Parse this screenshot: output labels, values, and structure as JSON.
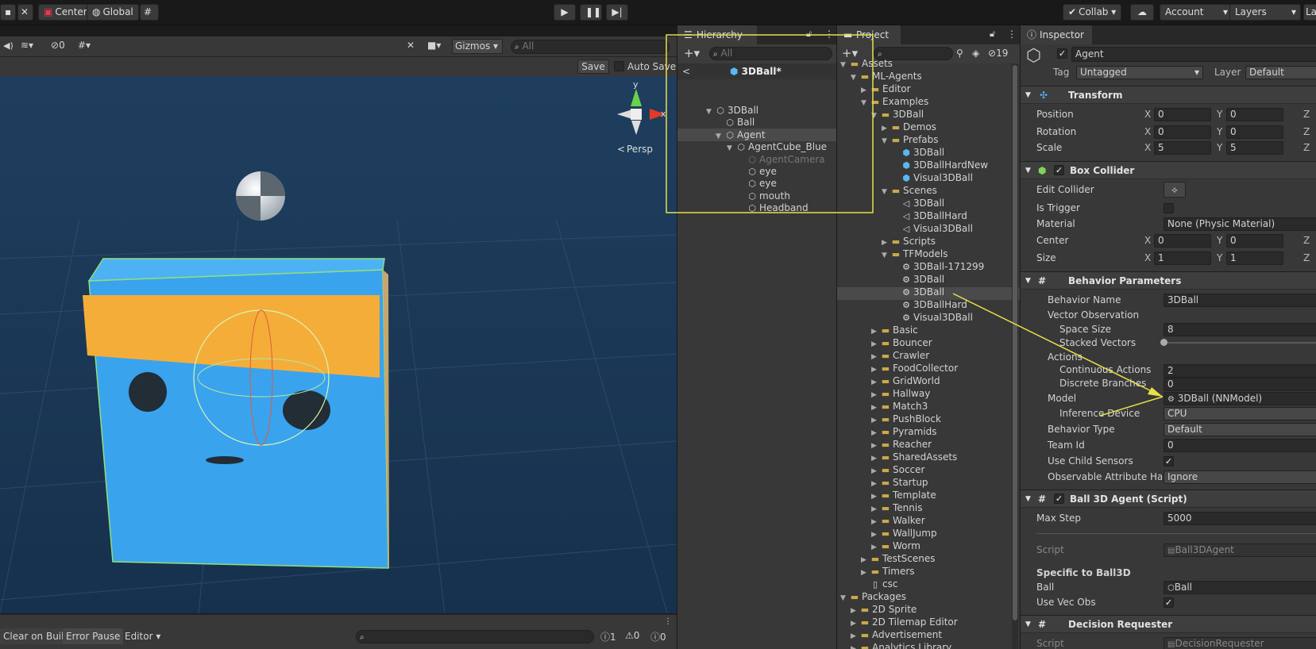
{
  "toolbar": {
    "center": "Center",
    "global": "Global",
    "collab": "Collab",
    "account": "Account",
    "layers": "Layers",
    "layout": "La"
  },
  "scene": {
    "gizmos": "Gizmos",
    "search_placeholder": "All",
    "save": "Save",
    "auto_save": "Auto Save",
    "hidden_count": "0",
    "persp": "Persp",
    "axis_y": "y",
    "axis_x": "x"
  },
  "console": {
    "clear_on_build": "Clear on Build",
    "error_pause": "Error Pause",
    "editor": "Editor",
    "count_info": "1",
    "count_warn": "0",
    "count_err": "0"
  },
  "hierarchy": {
    "title": "Hierarchy",
    "search_placeholder": "All",
    "scene_name": "3DBall*",
    "items": [
      "3DBall",
      "Ball",
      "Agent",
      "AgentCube_Blue",
      "AgentCamera",
      "eye",
      "eye",
      "mouth",
      "Headband"
    ]
  },
  "project": {
    "title": "Project",
    "badge": "19",
    "items": [
      "Assets",
      "ML-Agents",
      "Editor",
      "Examples",
      "3DBall",
      "Demos",
      "Prefabs",
      "3DBall",
      "3DBallHardNew",
      "Visual3DBall",
      "Scenes",
      "3DBall",
      "3DBallHard",
      "Visual3DBall",
      "Scripts",
      "TFModels",
      "3DBall-171299",
      "3DBall",
      "3DBall",
      "3DBallHard",
      "Visual3DBall",
      "Basic",
      "Bouncer",
      "Crawler",
      "FoodCollector",
      "GridWorld",
      "Hallway",
      "Match3",
      "PushBlock",
      "Pyramids",
      "Reacher",
      "SharedAssets",
      "Soccer",
      "Startup",
      "Template",
      "Tennis",
      "Walker",
      "WallJump",
      "Worm",
      "TestScenes",
      "Timers",
      "csc",
      "Packages",
      "2D Sprite",
      "2D Tilemap Editor",
      "Advertisement",
      "Analytics Library"
    ]
  },
  "inspector": {
    "title": "Inspector",
    "object_name": "Agent",
    "tag_label": "Tag",
    "tag_value": "Untagged",
    "layer_label": "Layer",
    "layer_value": "Default",
    "transform": {
      "title": "Transform",
      "position": "Position",
      "rotation": "Rotation",
      "scale": "Scale",
      "pos": [
        "0",
        "0"
      ],
      "rot": [
        "0",
        "0"
      ],
      "scl": [
        "5",
        "5"
      ]
    },
    "box_collider": {
      "title": "Box Collider",
      "edit_collider": "Edit Collider",
      "is_trigger": "Is Trigger",
      "material": "Material",
      "material_value": "None (Physic Material)",
      "center": "Center",
      "size": "Size",
      "center_v": [
        "0",
        "0"
      ],
      "size_v": [
        "1",
        "1"
      ]
    },
    "behavior": {
      "title": "Behavior Parameters",
      "behavior_name": "Behavior Name",
      "behavior_name_value": "3DBall",
      "vector_observation": "Vector Observation",
      "space_size": "Space Size",
      "space_size_value": "8",
      "stacked_vectors": "Stacked Vectors",
      "actions": "Actions",
      "continuous_actions": "Continuous Actions",
      "continuous_actions_value": "2",
      "discrete_branches": "Discrete Branches",
      "discrete_branches_value": "0",
      "model": "Model",
      "model_value": "3DBall (NNModel)",
      "inference_device": "Inference Device",
      "inference_device_value": "CPU",
      "behavior_type": "Behavior Type",
      "behavior_type_value": "Default",
      "team_id": "Team Id",
      "team_id_value": "0",
      "use_child_sensors": "Use Child Sensors",
      "observable": "Observable Attribute Hanc",
      "observable_value": "Ignore"
    },
    "agent_script": {
      "title": "Ball 3D Agent (Script)",
      "max_step": "Max Step",
      "max_step_value": "5000",
      "script": "Script",
      "script_value": "Ball3DAgent",
      "specific": "Specific to Ball3D",
      "ball": "Ball",
      "ball_value": "Ball",
      "use_vec_obs": "Use Vec Obs"
    },
    "decision": {
      "title": "Decision Requester",
      "script": "Script",
      "script_value": "DecisionRequester"
    }
  },
  "colors": {
    "highlight": "#e8e04a",
    "selection": "#4a4a4a",
    "accent": "#3a79bb"
  }
}
